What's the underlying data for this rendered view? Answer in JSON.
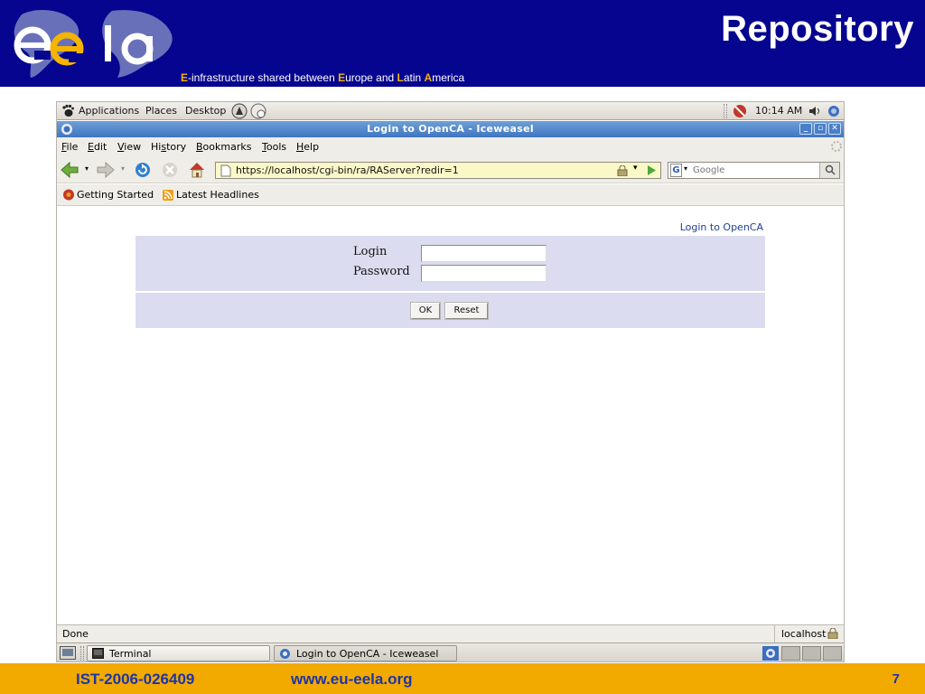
{
  "slide": {
    "title": "Repository",
    "tagline": {
      "e1": "E",
      "t1": "-infrastructure shared between ",
      "e2": "E",
      "t2": "urope and ",
      "e3": "L",
      "t3": "atin ",
      "e4": "A",
      "t4": "merica"
    },
    "footer": {
      "project_id": "IST-2006-026409",
      "url": "www.eu-eela.org",
      "page_number": "7"
    },
    "colors": {
      "header_bg": "#05058f",
      "footer_bg": "#f2a900",
      "footer_text": "#1d35a8",
      "tagline_accent": "#f4b400"
    }
  },
  "gnome_panel": {
    "menus": [
      "Applications",
      "Places",
      "Desktop"
    ],
    "clock": "10:14 AM"
  },
  "window": {
    "title": "Login to OpenCA - Iceweasel",
    "controls": [
      "minimize-icon",
      "maximize-icon",
      "close-icon"
    ]
  },
  "menubar": {
    "items": [
      {
        "pre": "",
        "u": "F",
        "post": "ile"
      },
      {
        "pre": "",
        "u": "E",
        "post": "dit"
      },
      {
        "pre": "",
        "u": "V",
        "post": "iew"
      },
      {
        "pre": "Hi",
        "u": "s",
        "post": "tory"
      },
      {
        "pre": "",
        "u": "B",
        "post": "ookmarks"
      },
      {
        "pre": "",
        "u": "T",
        "post": "ools"
      },
      {
        "pre": "",
        "u": "H",
        "post": "elp"
      }
    ]
  },
  "navbar": {
    "url": "https://localhost/cgi-bin/ra/RAServer?redir=1",
    "search_placeholder": "Google"
  },
  "bookmarks": {
    "items": [
      "Getting Started",
      "Latest Headlines"
    ]
  },
  "page": {
    "heading": "Login to OpenCA",
    "login_label": "Login",
    "password_label": "Password",
    "login_value": "",
    "password_value": "",
    "ok_label": "OK",
    "reset_label": "Reset",
    "colors": {
      "panel_bg": "#dcdcf0",
      "heading": "#1f3f8f"
    }
  },
  "statusbar": {
    "status": "Done",
    "host": "localhost"
  },
  "taskbar": {
    "tasks": [
      "Terminal",
      "Login to OpenCA - Iceweasel"
    ]
  }
}
